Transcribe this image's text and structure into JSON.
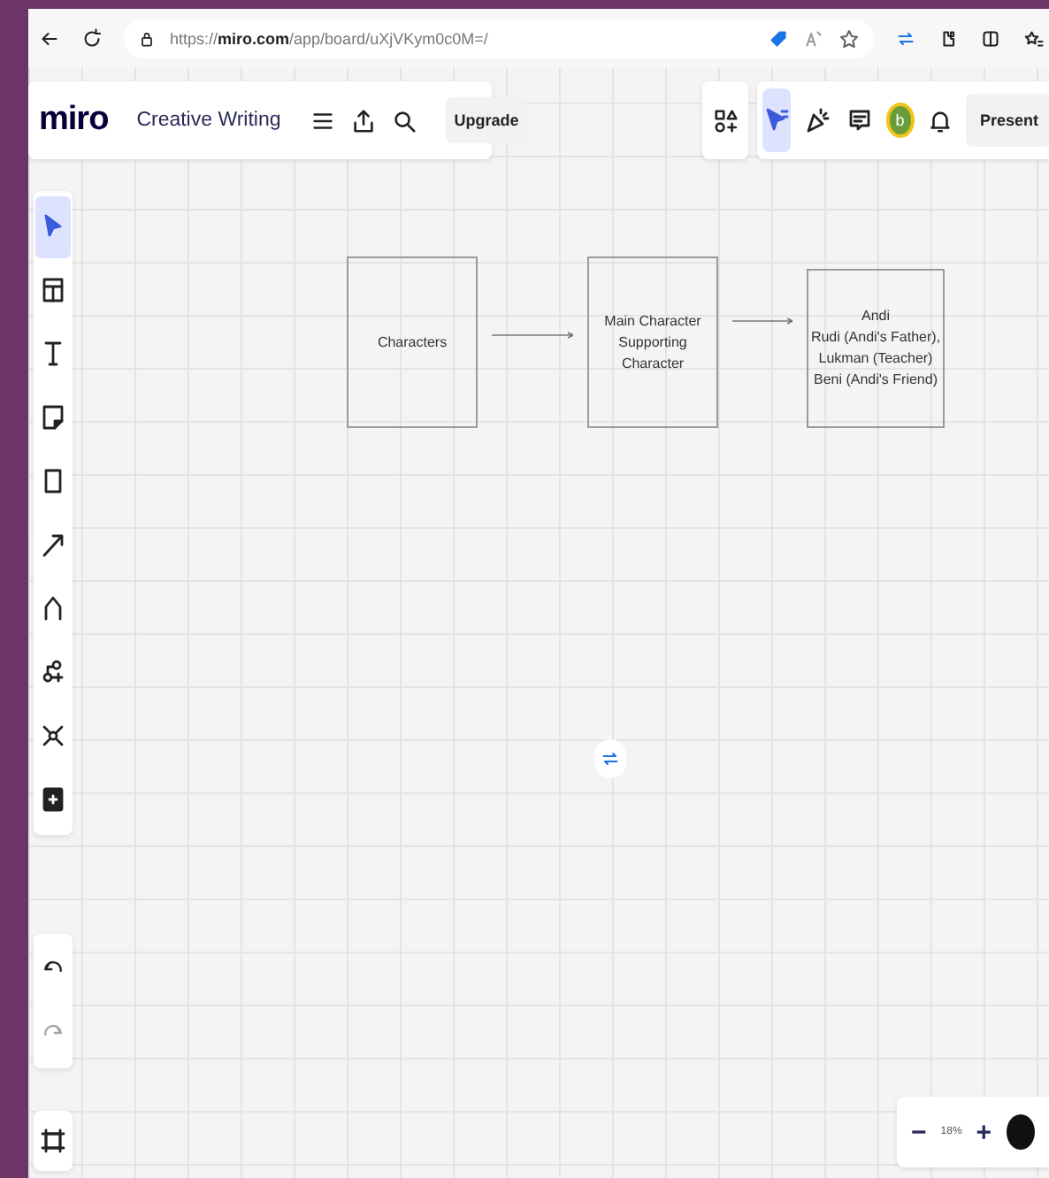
{
  "browser": {
    "url": "https://**miro.com**/app/board/uXjVKym0c0M=/"
  },
  "header": {
    "logo": "miro",
    "board_title": "Creative Writing",
    "upgrade": "Upgrade"
  },
  "top_tools": [
    {
      "kind": "cursor",
      "selected": true
    },
    {
      "kind": "celebrate",
      "selected": false
    },
    {
      "kind": "comment",
      "selected": false
    }
  ],
  "avatar": {
    "initial": "b"
  },
  "present": "Present",
  "toolbar": [
    {
      "kind": "select",
      "selected": true
    },
    {
      "kind": "frame",
      "selected": false
    },
    {
      "kind": "text",
      "selected": false
    },
    {
      "kind": "sticky",
      "selected": false
    },
    {
      "kind": "shape",
      "selected": false
    },
    {
      "kind": "arrow",
      "selected": false
    },
    {
      "kind": "pen",
      "selected": false
    },
    {
      "kind": "mindmap",
      "selected": false
    },
    {
      "kind": "connect",
      "selected": false
    },
    {
      "kind": "more",
      "selected": false
    }
  ],
  "history": [
    {
      "kind": "undo",
      "disabled": false
    },
    {
      "kind": "redo",
      "disabled": true
    }
  ],
  "nodes": [
    {
      "lines": [
        "Characters"
      ]
    },
    {
      "lines": [
        "Main Character",
        "Supporting",
        "Character"
      ]
    },
    {
      "lines": [
        "Andi",
        "Rudi (Andi's Father),",
        "Lukman (Teacher)",
        "Beni (Andi's Friend)"
      ]
    }
  ],
  "zoom": {
    "minus": "−",
    "reading": "18%",
    "plus": "+"
  }
}
